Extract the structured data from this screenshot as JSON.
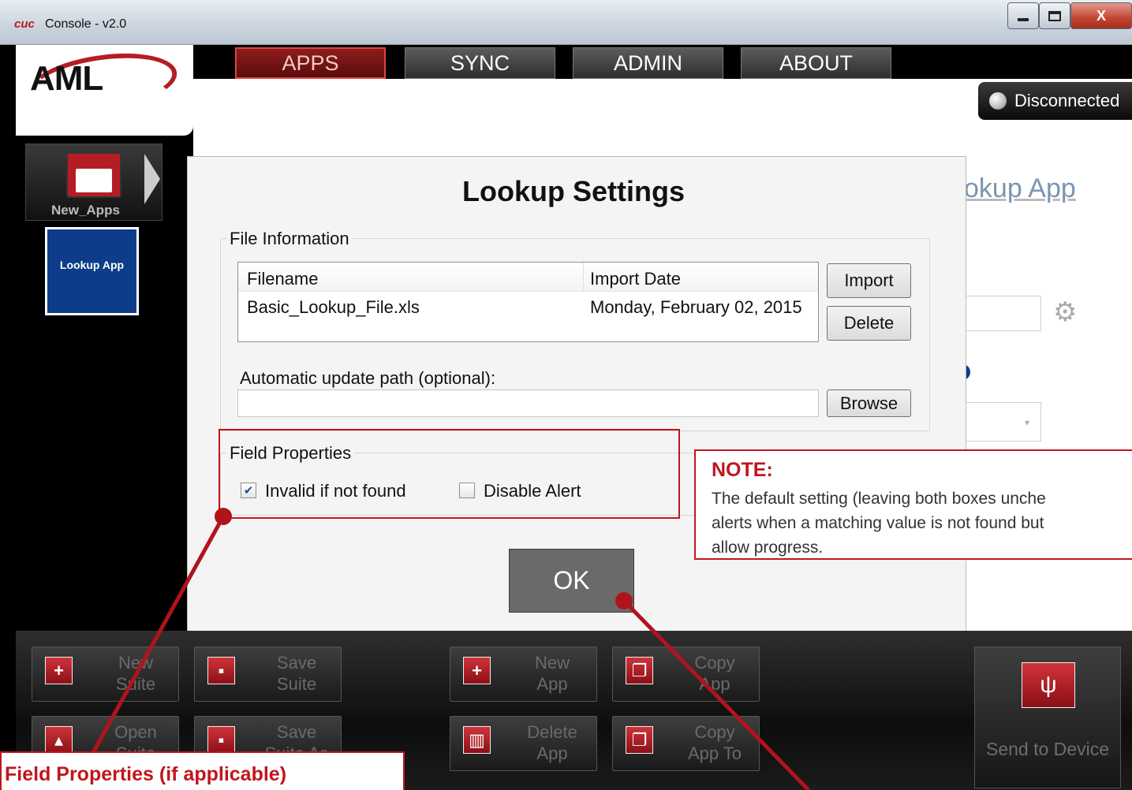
{
  "window": {
    "title": "Console - v2.0",
    "logo": "cuc",
    "controls": [
      "minimize-icon",
      "maximize-icon",
      "close-icon"
    ],
    "close_glyph": "X"
  },
  "brand": {
    "logo_text": "AML"
  },
  "nav": {
    "tabs": [
      {
        "label": "APPS",
        "active": true
      },
      {
        "label": "SYNC",
        "active": false
      },
      {
        "label": "ADMIN",
        "active": false
      },
      {
        "label": "ABOUT",
        "active": false
      }
    ]
  },
  "status": {
    "label": "Disconnected"
  },
  "sidebar": {
    "folder_label": "New_Apps",
    "app_tile_label": "Lookup App"
  },
  "background_page": {
    "title_fragment": "okup App"
  },
  "dialog": {
    "title": "Lookup Settings",
    "file_info": {
      "group_label": "File Information",
      "columns": [
        "Filename",
        "Import Date"
      ],
      "rows": [
        {
          "filename": "Basic_Lookup_File.xls",
          "import_date": "Monday, February 02, 2015"
        }
      ],
      "import_label": "Import",
      "delete_label": "Delete",
      "update_path_label": "Automatic update path (optional):",
      "update_path_value": "",
      "browse_label": "Browse"
    },
    "field_properties": {
      "group_label": "Field Properties",
      "invalid_if_not_found": {
        "label": "Invalid if not found",
        "checked": true
      },
      "disable_alert": {
        "label": "Disable Alert",
        "checked": false
      }
    },
    "ok_label": "OK"
  },
  "toolbar": {
    "new_suite": "New Suite",
    "save_suite": "Save Suite",
    "new_app": "New App",
    "copy_app": "Copy App",
    "open_suite": "Open Suite",
    "save_suite_as": "Save Suite As",
    "delete_app": "Delete App",
    "copy_app_to": "Copy App To",
    "send_to_device": "Send to Device"
  },
  "annotations": {
    "note_title": "NOTE:",
    "note_lines": [
      "The default setting (leaving both boxes unche",
      "alerts when a matching value is not found but",
      "allow progress."
    ],
    "callout_label": "Field Properties (if applicable)",
    "accent_color": "#c0161d"
  },
  "colors": {
    "brand_red": "#b51d25",
    "app_tile_blue": "#0d3d8a",
    "link_blue": "#7a95b0"
  }
}
